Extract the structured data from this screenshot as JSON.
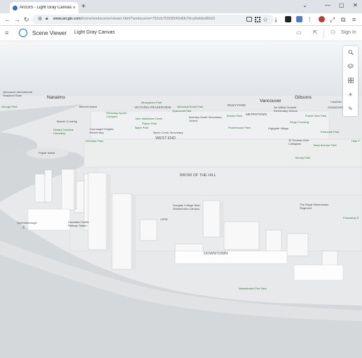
{
  "browser": {
    "tab_title": "ArcGIS - Light Gray Canvas",
    "tab_close": "×",
    "new_tab": "+",
    "url_host": "www.arcgis.com",
    "url_path": "/home/webscene/viewer.html?webscene=752cb7f293f340d0b79ca5ebfed6593"
  },
  "app": {
    "name": "Scene Viewer",
    "scene_title": "Light Gray Canvas",
    "sign_in": "Sign In"
  },
  "map_labels": {
    "cities": [
      {
        "text": "Vancouver"
      },
      {
        "text": "Nanaimo"
      },
      {
        "text": "Gibsons"
      }
    ],
    "districts": [
      {
        "text": "WEST END"
      },
      {
        "text": "BROW OF THE HILL"
      },
      {
        "text": "DOWNTOWN"
      },
      {
        "text": "VICTORIA-FRASERVIEW"
      },
      {
        "text": "RILEY PARK"
      },
      {
        "text": "METROTOWN"
      }
    ],
    "places": [
      {
        "text": "Vancouver International Seaplane Base"
      },
      {
        "text": "George Park"
      },
      {
        "text": "Mitchell Island"
      },
      {
        "text": "Musqueam Park"
      },
      {
        "text": "Memorial South Park"
      },
      {
        "text": "Riverway Sports Complex"
      },
      {
        "text": "Sparwood Park"
      },
      {
        "text": "John Matthews Creek"
      },
      {
        "text": "Burnaby South Secondary School"
      },
      {
        "text": "Market Crossing"
      },
      {
        "text": "Rayne Park"
      },
      {
        "text": "Taylor Park"
      },
      {
        "text": "Schara Tzedeck Cemetery"
      },
      {
        "text": "Connaught Heights Elementary"
      },
      {
        "text": "Byrne Creek Secondary"
      },
      {
        "text": "Grimston Park"
      },
      {
        "text": "Boston Park"
      },
      {
        "text": "Sir Wilfrid Grenfell Elementary School"
      },
      {
        "text": "Powerhouse Park"
      },
      {
        "text": "Highgate Village"
      },
      {
        "text": "Kings Crossing"
      },
      {
        "text": "Forest Glen Park"
      },
      {
        "text": "Caulfeild"
      },
      {
        "text": "GRANDVIEW"
      },
      {
        "text": "Edmonds Park"
      },
      {
        "text": "Hide P"
      },
      {
        "text": "St Thomas More Collegiate"
      },
      {
        "text": "Mary Avenue Park"
      },
      {
        "text": "Poplar Island"
      },
      {
        "text": "Moody Park"
      },
      {
        "text": "Douglas College New Westminster Campus"
      },
      {
        "text": "The Royal Westminster Regiment"
      },
      {
        "text": "Friendship S"
      },
      {
        "text": "Queensborough"
      },
      {
        "text": "Canadian Pacific Railway Station"
      },
      {
        "text": "CEPA"
      },
      {
        "text": "Westminster Pier Park"
      }
    ]
  },
  "icons": {
    "search": "search-icon",
    "layers": "layers-icon",
    "basemap": "basemap-gallery-icon",
    "daylight": "sun-icon",
    "measure": "measure-icon"
  },
  "colors": {
    "accent": "#0079c1",
    "park_label": "#2e7d32",
    "map_ground": "#e6e7e8",
    "water": "#d3d6d9"
  }
}
